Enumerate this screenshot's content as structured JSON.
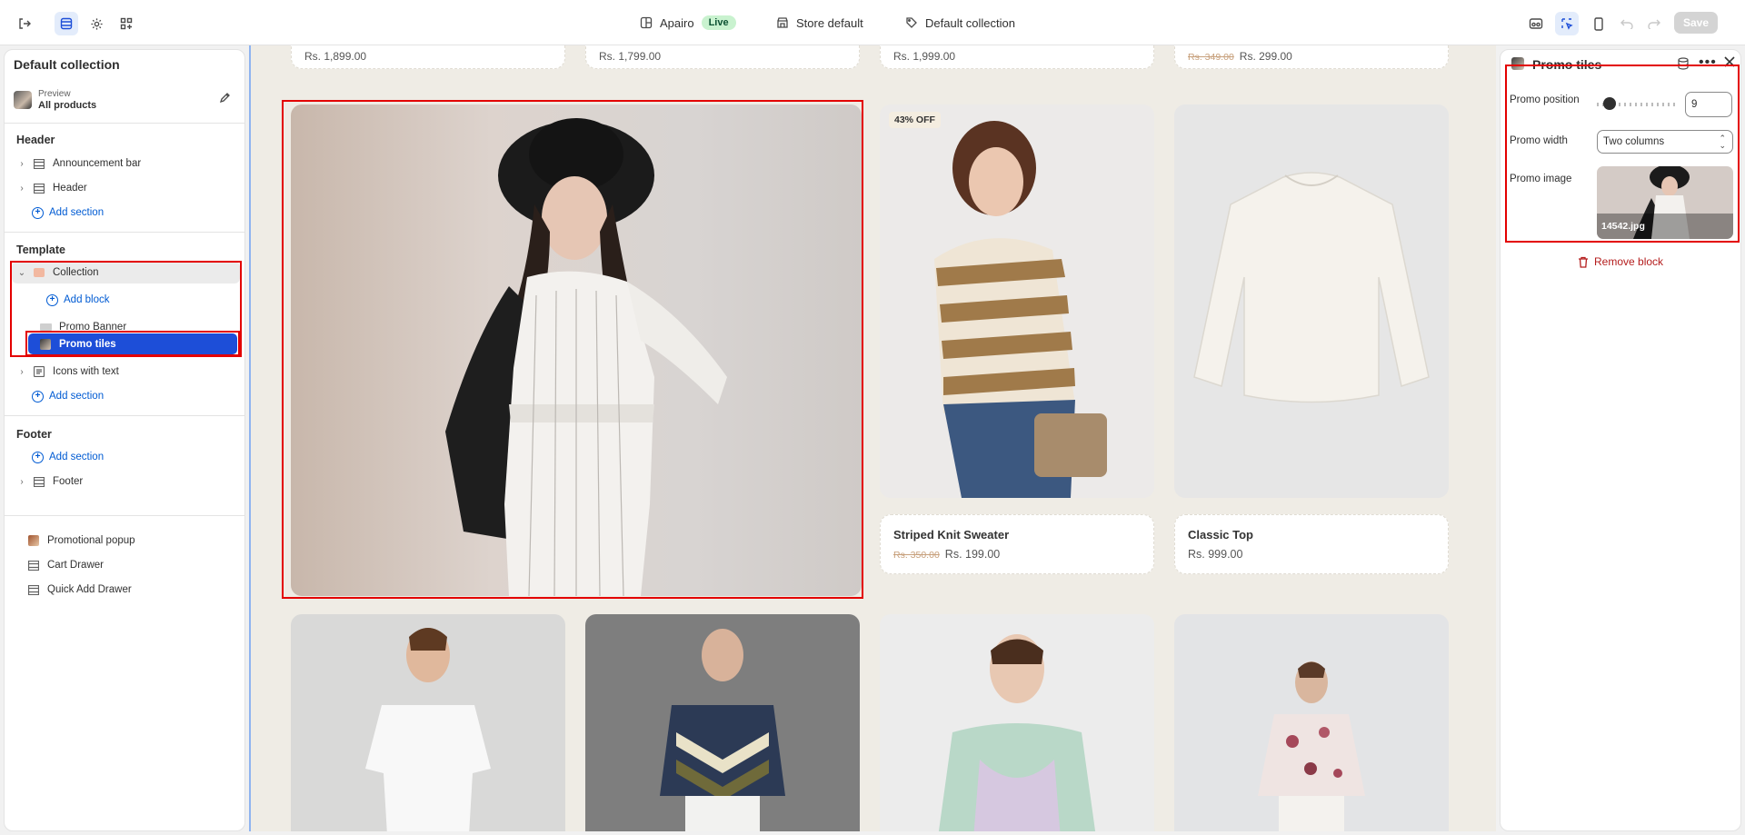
{
  "topbar": {
    "store_name": "Apairo",
    "live_badge": "Live",
    "theme_label": "Store default",
    "template_label": "Default collection",
    "save_label": "Save"
  },
  "left_panel": {
    "title": "Default collection",
    "preview_small": "Preview",
    "preview_main": "All products",
    "header_group": {
      "heading": "Header",
      "items": [
        "Announcement bar",
        "Header"
      ],
      "add": "Add section"
    },
    "template_group": {
      "heading": "Template",
      "collection": "Collection",
      "add_block": "Add block",
      "blocks": [
        "Promo Banner",
        "Promo tiles"
      ],
      "icons_with_text": "Icons with text",
      "add": "Add section"
    },
    "footer_group": {
      "heading": "Footer",
      "add": "Add section",
      "footer": "Footer"
    },
    "overlays": [
      "Promotional popup",
      "Cart Drawer",
      "Quick Add Drawer"
    ]
  },
  "canvas": {
    "top_prices": [
      "Rs. 1,899.00",
      "Rs. 1,799.00",
      "Rs. 1,999.00"
    ],
    "top_price4_old": "Rs. 349.00",
    "top_price4_new": "Rs. 299.00",
    "badge": "43% OFF",
    "products": [
      {
        "name": "Striped Knit Sweater",
        "old_price": "Rs. 350.00",
        "price": "Rs. 199.00"
      },
      {
        "name": "Classic Top",
        "price": "Rs. 999.00"
      }
    ]
  },
  "right_panel": {
    "title": "Promo tiles",
    "position_label": "Promo position",
    "position_value": "9",
    "slider_fraction": 0.15,
    "width_label": "Promo width",
    "width_value": "Two columns",
    "image_label": "Promo image",
    "image_file": "14542.jpg",
    "remove_label": "Remove block"
  },
  "colors": {
    "accent": "#005bd3",
    "selected": "#1d4ed8",
    "highlight": "#e30000",
    "danger": "#b41c1c"
  }
}
